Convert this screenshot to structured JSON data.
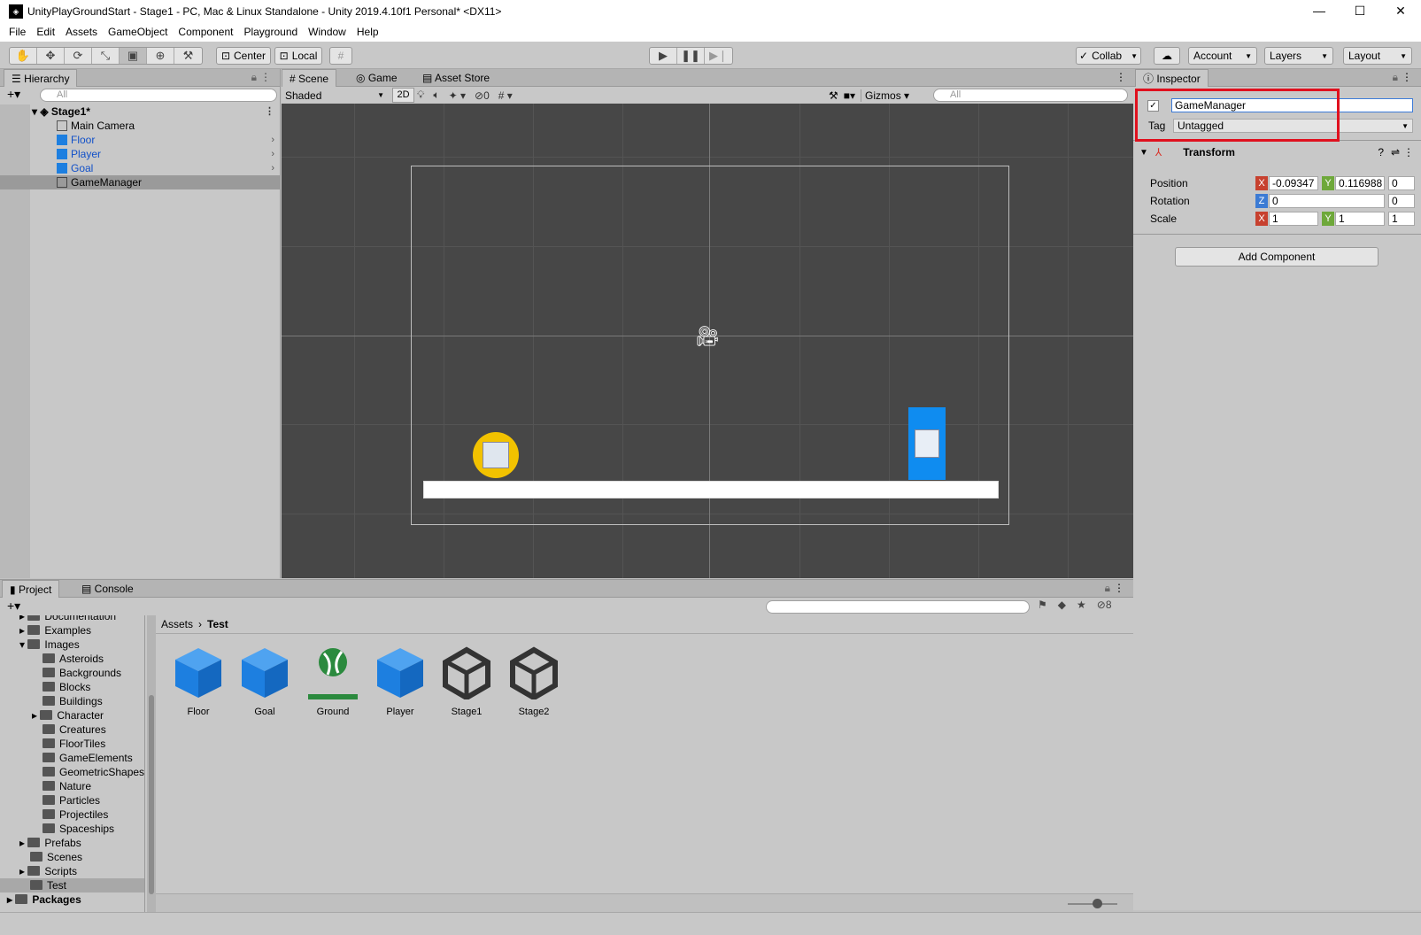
{
  "window": {
    "title": "UnityPlayGroundStart - Stage1 - PC, Mac & Linux Standalone - Unity 2019.4.10f1 Personal* <DX11>",
    "app_icon": "unity-icon"
  },
  "menu": [
    "File",
    "Edit",
    "Assets",
    "GameObject",
    "Component",
    "Playground",
    "Window",
    "Help"
  ],
  "toolbar": {
    "pivot": "Center",
    "space": "Local",
    "collab": "Collab",
    "account": "Account",
    "layers": "Layers",
    "layout": "Layout"
  },
  "hierarchy": {
    "tab": "Hierarchy",
    "search_placeholder": "All",
    "scene": "Stage1*",
    "items": [
      {
        "label": "Main Camera"
      },
      {
        "label": "Floor"
      },
      {
        "label": "Player"
      },
      {
        "label": "Goal"
      },
      {
        "label": "GameManager"
      }
    ]
  },
  "scene_view": {
    "tabs": [
      "Scene",
      "Game",
      "Asset Store"
    ],
    "shading": "Shaded",
    "mode_2d": "2D",
    "hidden_count": "0",
    "gizmos": "Gizmos",
    "search_placeholder": "All"
  },
  "inspector": {
    "tab": "Inspector",
    "object_name": "GameManager",
    "tag_label": "Tag",
    "tag_value": "Untagged",
    "transform": {
      "title": "Transform",
      "position_label": "Position",
      "rotation_label": "Rotation",
      "scale_label": "Scale",
      "pos_x": "-0.09347",
      "pos_y": "0.116988",
      "pos_z": "0",
      "rot_z": "0",
      "rot_last": "0",
      "scale_x": "1",
      "scale_y": "1",
      "scale_z": "1",
      "axis_x": "X",
      "axis_y": "Y",
      "axis_z": "Z"
    },
    "add_component": "Add Component",
    "highlight_color": "#e0101e"
  },
  "project": {
    "tabs": [
      "Project",
      "Console"
    ],
    "hidden_count": "8",
    "breadcrumb_root": "Assets",
    "breadcrumb_current": "Test",
    "tree": [
      {
        "label": "Documentation"
      },
      {
        "label": "Examples"
      },
      {
        "label": "Images"
      },
      {
        "label": "Asteroids"
      },
      {
        "label": "Backgrounds"
      },
      {
        "label": "Blocks"
      },
      {
        "label": "Buildings"
      },
      {
        "label": "Character"
      },
      {
        "label": "Creatures"
      },
      {
        "label": "FloorTiles"
      },
      {
        "label": "GameElements"
      },
      {
        "label": "GeometricShapes"
      },
      {
        "label": "Nature"
      },
      {
        "label": "Particles"
      },
      {
        "label": "Projectiles"
      },
      {
        "label": "Spaceships"
      },
      {
        "label": "Prefabs"
      },
      {
        "label": "Scenes"
      },
      {
        "label": "Scripts"
      },
      {
        "label": "Test"
      },
      {
        "label": "Packages"
      }
    ],
    "assets": [
      {
        "label": "Floor",
        "icon": "prefab-cube-icon"
      },
      {
        "label": "Goal",
        "icon": "prefab-cube-icon"
      },
      {
        "label": "Ground",
        "icon": "tilemap-ground-icon"
      },
      {
        "label": "Player",
        "icon": "prefab-cube-icon"
      },
      {
        "label": "Stage1",
        "icon": "unity-scene-icon"
      },
      {
        "label": "Stage2",
        "icon": "unity-scene-icon"
      }
    ]
  },
  "colors": {
    "prefab_blue": "#1d7fe0",
    "player_blue": "#0f8cf0",
    "goal_yellow": "#f2c200",
    "ground_green": "#2b8a3e"
  }
}
